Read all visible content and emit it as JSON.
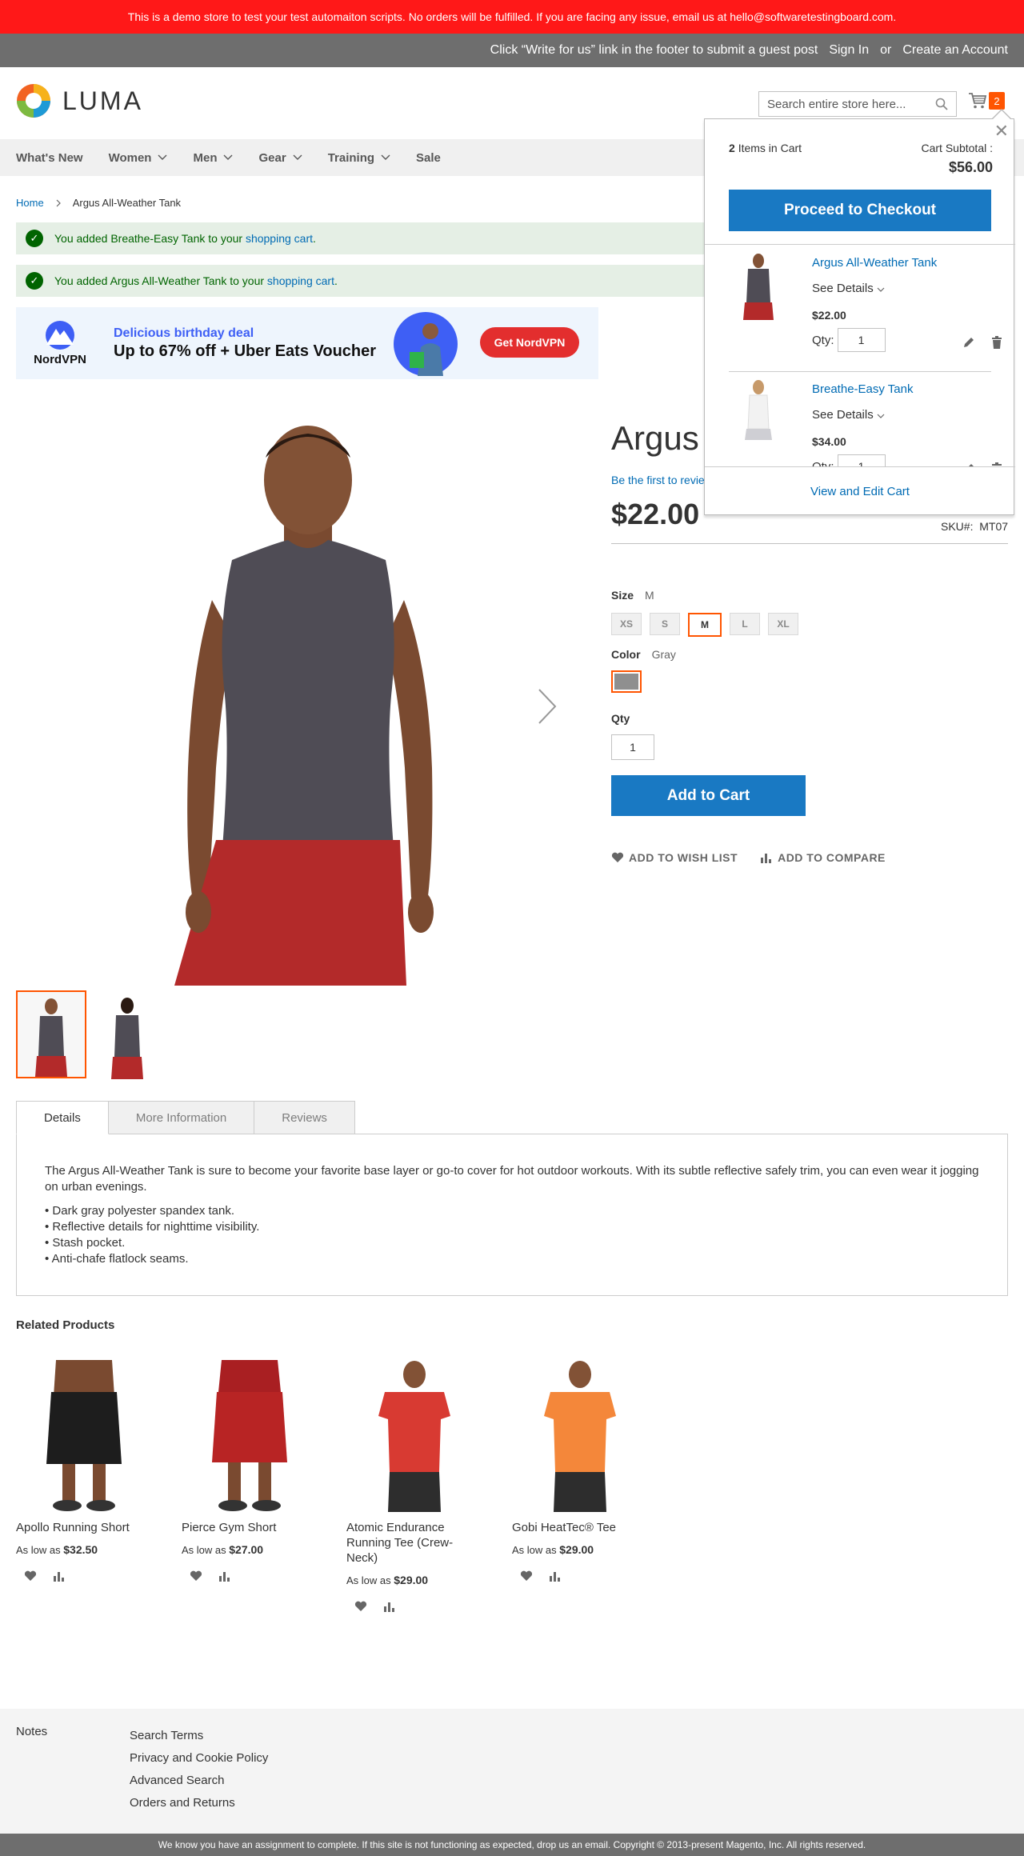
{
  "demo_notice": "This is a demo store to test your test automaiton scripts. No orders will be fulfilled. If you are facing any issue, email us at hello@softwaretestingboard.com.",
  "header": {
    "write_for_us": "Click “Write for us” link in the footer to submit a guest post",
    "sign_in": "Sign In",
    "or": "or",
    "create_account": "Create an Account"
  },
  "logo": {
    "text": "LUMA"
  },
  "search": {
    "placeholder": "Search entire store here..."
  },
  "cart": {
    "count": "2"
  },
  "nav": {
    "items": [
      {
        "label": "What's New",
        "dropdown": false
      },
      {
        "label": "Women",
        "dropdown": true
      },
      {
        "label": "Men",
        "dropdown": true
      },
      {
        "label": "Gear",
        "dropdown": true
      },
      {
        "label": "Training",
        "dropdown": true
      },
      {
        "label": "Sale",
        "dropdown": false
      }
    ]
  },
  "breadcrumb": {
    "home": "Home",
    "current": "Argus All-Weather Tank"
  },
  "messages": [
    {
      "prefix": "You added Breathe-Easy Tank to your ",
      "link": "shopping cart",
      "suffix": "."
    },
    {
      "prefix": "You added Argus All-Weather Tank to your ",
      "link": "shopping cart",
      "suffix": "."
    }
  ],
  "ad": {
    "brand": "NordVPN",
    "deal": "Delicious birthday deal",
    "offer": "Up to 67% off + Uber Eats Voucher",
    "button": "Get NordVPN"
  },
  "product": {
    "title": "Argus All-Weather Tank",
    "review_link": "Be the first to review this product",
    "price": "$22.00",
    "sku_label": "SKU#:",
    "sku": "MT07",
    "size_label": "Size",
    "size_selected": "M",
    "sizes": [
      "XS",
      "S",
      "M",
      "L",
      "XL"
    ],
    "color_label": "Color",
    "color_selected": "Gray",
    "color_hex": "#8f8f8f",
    "qty_label": "Qty",
    "qty": "1",
    "add_to_cart": "Add to Cart",
    "wishlist": "ADD TO WISH LIST",
    "compare": "ADD TO COMPARE"
  },
  "tabs": {
    "items": [
      "Details",
      "More Information",
      "Reviews"
    ],
    "details_text": "The Argus All-Weather Tank is sure to become your favorite base layer or go-to cover for hot outdoor workouts. With its subtle reflective safely trim, you can even wear it jogging on urban evenings.",
    "bullets": [
      "• Dark gray polyester spandex tank.",
      "• Reflective details for nighttime visibility.",
      "• Stash pocket.",
      "• Anti-chafe flatlock seams."
    ]
  },
  "related": {
    "title": "Related Products",
    "as_low_as": "As low as",
    "products": [
      {
        "name": "Apollo Running Short",
        "price": "$32.50",
        "shirt": "#2b2b2b",
        "shorts": "#1d1d1d"
      },
      {
        "name": "Pierce Gym Short",
        "price": "$27.00",
        "shirt": "#a91f22",
        "shorts": "#b82424"
      },
      {
        "name": "Atomic Endurance Running Tee (Crew-Neck)",
        "price": "$29.00",
        "shirt": "#d83a32",
        "shorts": "#2d2d2d"
      },
      {
        "name": "Gobi HeatTec® Tee",
        "price": "$29.00",
        "shirt": "#f4873a",
        "shorts": "#2d2d2d"
      }
    ]
  },
  "footer": {
    "notes": "Notes",
    "links": [
      "Search Terms",
      "Privacy and Cookie Policy",
      "Advanced Search",
      "Orders and Returns"
    ],
    "copyright": "We know you have an assignment to complete. If this site is not functioning as expected, drop us an email. Copyright © 2013-present Magento, Inc. All rights reserved."
  },
  "minicart": {
    "count": "2",
    "items_label": "Items in Cart",
    "subtotal_label": "Cart Subtotal :",
    "subtotal": "$56.00",
    "checkout": "Proceed to Checkout",
    "see_details": "See Details",
    "qty_label": "Qty:",
    "view_edit": "View and Edit Cart",
    "items": [
      {
        "name": "Argus All-Weather Tank",
        "price": "$22.00",
        "qty": "1"
      },
      {
        "name": "Breathe-Easy Tank",
        "price": "$34.00",
        "qty": "1"
      }
    ]
  },
  "colors": {
    "primary": "#1979c3",
    "accent": "#ff5501",
    "demo_bar": "#ff1818",
    "link": "#006bb4"
  }
}
